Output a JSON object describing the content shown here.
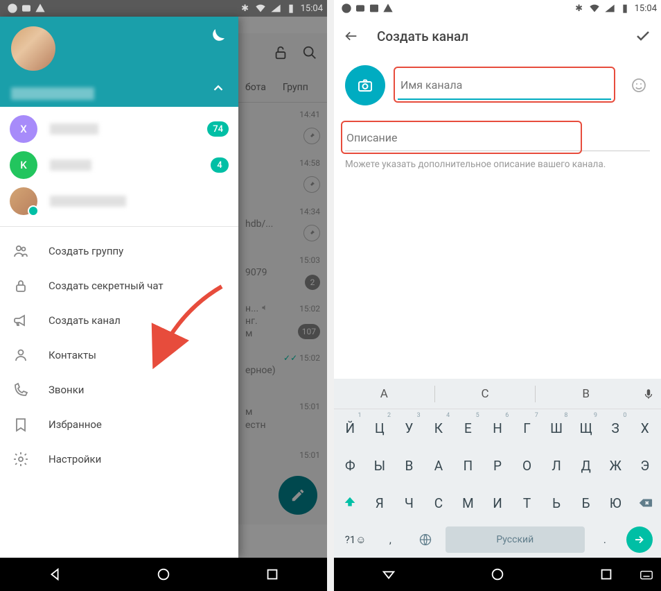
{
  "status": {
    "time": "15:04"
  },
  "left": {
    "accounts": [
      {
        "initial": "X",
        "color": "#a78bfa",
        "badge": "74"
      },
      {
        "initial": "K",
        "color": "#22c55e",
        "badge": "4"
      },
      {
        "initial": "",
        "color": "linear",
        "badge": ""
      }
    ],
    "menu": {
      "create_group": "Создать группу",
      "create_secret": "Создать секретный чат",
      "create_channel": "Создать канал",
      "contacts": "Контакты",
      "calls": "Звонки",
      "saved": "Избранное",
      "settings": "Настройки"
    },
    "behind": {
      "tabs": {
        "work": "бота",
        "groups": "Групп"
      },
      "times": [
        "14:41",
        "14:58",
        "14:34",
        "15:03",
        "15:02",
        "15:02",
        "15:01",
        "15:01"
      ],
      "snip1": "hdb/...",
      "snip2": "9079",
      "snip3a": "н...",
      "snip3b": "нг.",
      "snip3c": "м",
      "snip4": "ерное)",
      "snip5a": "м",
      "snip5b": "естн",
      "badge107": "107",
      "badge2": "2"
    }
  },
  "right": {
    "title": "Создать канал",
    "name_placeholder": "Имя канала",
    "desc_placeholder": "Описание",
    "hint": "Можете указать дополнительное описание вашего канала."
  },
  "keyboard": {
    "suggestions": [
      "А",
      "С",
      "В"
    ],
    "row1": [
      {
        "k": "Й",
        "n": "1"
      },
      {
        "k": "Ц",
        "n": "2"
      },
      {
        "k": "У",
        "n": "3"
      },
      {
        "k": "К",
        "n": "4"
      },
      {
        "k": "Е",
        "n": "5"
      },
      {
        "k": "Н",
        "n": "6"
      },
      {
        "k": "Г",
        "n": "7"
      },
      {
        "k": "Ш",
        "n": "8"
      },
      {
        "k": "Щ",
        "n": "9"
      },
      {
        "k": "З",
        "n": "0"
      },
      {
        "k": "Х",
        "n": ""
      }
    ],
    "row2": [
      "Ф",
      "Ы",
      "В",
      "А",
      "П",
      "Р",
      "О",
      "Л",
      "Д",
      "Ж",
      "Э"
    ],
    "row3": [
      "Я",
      "Ч",
      "С",
      "М",
      "И",
      "Т",
      "Ь",
      "Б",
      "Ю"
    ],
    "sym": "?1☺",
    "comma": ",",
    "space": "Русский",
    "dot": "."
  }
}
